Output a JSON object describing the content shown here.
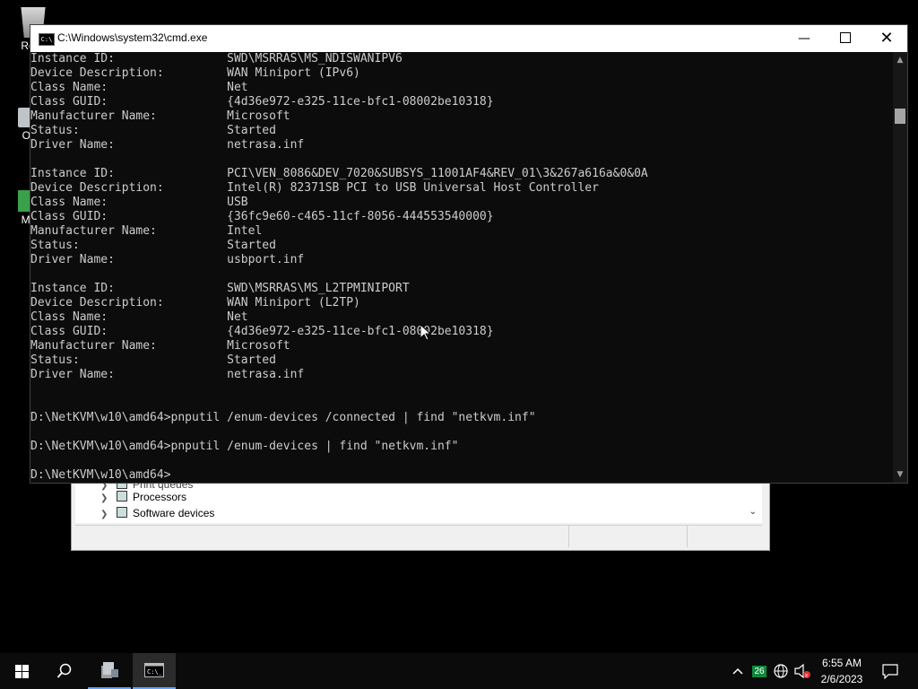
{
  "desktop": {
    "icons": [
      {
        "label": "Recy"
      },
      {
        "label": "OSF"
      },
      {
        "label": "Mem"
      }
    ]
  },
  "devmgr": {
    "rows": [
      {
        "label": "Print queues"
      },
      {
        "label": "Processors"
      },
      {
        "label": "Software devices"
      }
    ]
  },
  "cmd": {
    "title": "C:\\Windows\\system32\\cmd.exe",
    "lines": [
      "Instance ID:                SWD\\MSRRAS\\MS_NDISWANIPV6",
      "Device Description:         WAN Miniport (IPv6)",
      "Class Name:                 Net",
      "Class GUID:                 {4d36e972-e325-11ce-bfc1-08002be10318}",
      "Manufacturer Name:          Microsoft",
      "Status:                     Started",
      "Driver Name:                netrasa.inf",
      "",
      "Instance ID:                PCI\\VEN_8086&DEV_7020&SUBSYS_11001AF4&REV_01\\3&267a616a&0&0A",
      "Device Description:         Intel(R) 82371SB PCI to USB Universal Host Controller",
      "Class Name:                 USB",
      "Class GUID:                 {36fc9e60-c465-11cf-8056-444553540000}",
      "Manufacturer Name:          Intel",
      "Status:                     Started",
      "Driver Name:                usbport.inf",
      "",
      "Instance ID:                SWD\\MSRRAS\\MS_L2TPMINIPORT",
      "Device Description:         WAN Miniport (L2TP)",
      "Class Name:                 Net",
      "Class GUID:                 {4d36e972-e325-11ce-bfc1-08002be10318}",
      "Manufacturer Name:          Microsoft",
      "Status:                     Started",
      "Driver Name:                netrasa.inf",
      "",
      "",
      "D:\\NetKVM\\w10\\amd64>pnputil /enum-devices /connected | find \"netkvm.inf\"",
      "",
      "D:\\NetKVM\\w10\\amd64>pnputil /enum-devices | find \"netkvm.inf\"",
      "",
      "D:\\NetKVM\\w10\\amd64>"
    ]
  },
  "taskbar": {
    "badge_count": "26",
    "time": "6:55 AM",
    "date": "2/6/2023"
  }
}
